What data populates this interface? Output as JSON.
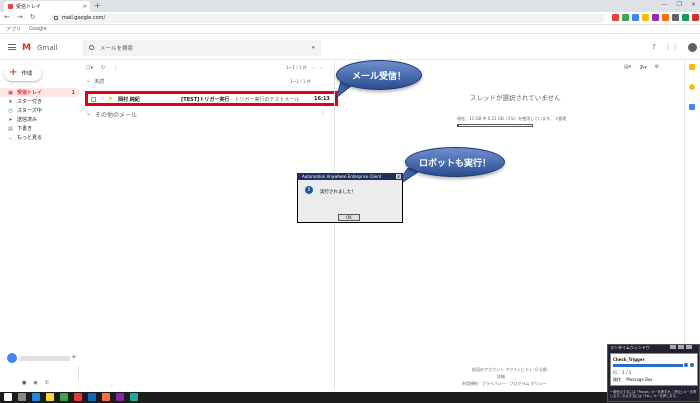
{
  "browser": {
    "tab_title": "受信トレイ",
    "url": "mail.google.com/",
    "bookmarks": [
      "アプリ",
      "Google"
    ]
  },
  "gmail": {
    "logo_text": "Gmail",
    "search_placeholder": "メールを検索",
    "compose_label": "作成",
    "sidebar": [
      {
        "label": "受信トレイ",
        "icon": "inbox-icon",
        "count": "1"
      },
      {
        "label": "スター付き",
        "icon": "star-icon"
      },
      {
        "label": "スヌーズ中",
        "icon": "clock-icon"
      },
      {
        "label": "送信済み",
        "icon": "send-icon"
      },
      {
        "label": "下書き",
        "icon": "draft-icon"
      },
      {
        "label": "もっと見る",
        "icon": "chevron-down-icon"
      }
    ],
    "pager": "1～1 / 1 件",
    "sections": {
      "unread": "未読",
      "unread_count": "1～1 / 1 件",
      "other": "その他のメール"
    },
    "message": {
      "from": "岡村 純紀",
      "subject": "[TEST]トリガー実行",
      "snippet": " - トリガー実行のテストメール",
      "time": "16:13"
    },
    "preview": {
      "no_selection": "スレッドが選択されていません",
      "storage": "現在、15 GB 中 0.21 GB（1%）を使用しています。 ⇗管理",
      "storage_fraction": 0.01,
      "footer_activity": "前回のアカウント アクティビティ: 0 分前",
      "footer_detail": "詳細",
      "footer_links": "利用規約 · プライバシー · プログラム ポリシー"
    }
  },
  "callouts": {
    "mail_received": "メール受信！",
    "robot_run": "ロボットも実行！"
  },
  "dialog": {
    "title": "Automation Anywhere Enterprise Client",
    "message": "実行されました！",
    "ok": "OK"
  },
  "runtime": {
    "title": "ランタイムウィンドウ",
    "task": "Check_Trigger",
    "line1": "行：   1 / 1",
    "line2": "操作：   Message Box",
    "hint": "一時停止するには「Pause」キーを押すか、[停止] キーを押します。中止するには「Esc」キーを押します。"
  },
  "colors": {
    "red_box": "#e60012",
    "callout_blue": "#294e8f",
    "gmail_red": "#d93025"
  }
}
